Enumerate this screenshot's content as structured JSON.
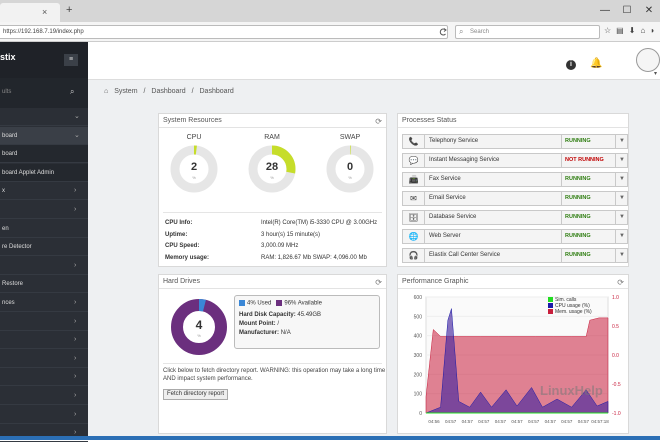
{
  "browser": {
    "tab_close": "×",
    "new_tab": "+",
    "url": "https://192.168.7.19/index.php",
    "search_placeholder": "Search",
    "window_buttons": [
      "—",
      "☐",
      "✕"
    ]
  },
  "sidebar": {
    "logo": "stix",
    "search_placeholder": "ults",
    "items": [
      {
        "label": "",
        "chevron": "⌄"
      },
      {
        "label": "board",
        "chevron": "⌄",
        "active": true
      },
      {
        "label": "board",
        "sub": true
      },
      {
        "label": "board Applet Admin",
        "sub": true
      },
      {
        "label": "x",
        "chevron": "›"
      },
      {
        "label": "",
        "chevron": "›"
      },
      {
        "label": "en"
      },
      {
        "label": "re Detector"
      },
      {
        "label": "",
        "chevron": "›"
      },
      {
        "label": "Restore"
      },
      {
        "label": "nces",
        "chevron": "›"
      },
      {
        "label": "",
        "chevron": "›"
      },
      {
        "label": "",
        "chevron": "›"
      },
      {
        "label": "",
        "chevron": "›"
      },
      {
        "label": "",
        "chevron": "›"
      },
      {
        "label": "",
        "chevron": "›"
      },
      {
        "label": "",
        "chevron": "›"
      },
      {
        "label": "",
        "chevron": "›"
      }
    ]
  },
  "topbar": {
    "info": "i"
  },
  "breadcrumb": {
    "home": "⌂",
    "items": [
      "System",
      "/",
      "Dashboard",
      "/",
      "Dashboard"
    ]
  },
  "system_resources": {
    "title": "System Resources",
    "gauges": [
      {
        "label": "CPU",
        "value": "2",
        "percent": 2,
        "color": "#c6dd2a"
      },
      {
        "label": "RAM",
        "value": "28",
        "percent": 28,
        "color": "#c6dd2a"
      },
      {
        "label": "SWAP",
        "value": "0",
        "percent": 0,
        "color": "#c6dd2a"
      }
    ],
    "pct_sign": "%",
    "info": [
      {
        "k": "CPU Info:",
        "v": "Intel(R) Core(TM) i5-3330 CPU @ 3.00GHz"
      },
      {
        "k": "Uptime:",
        "v": "3 hour(s) 15 minute(s)"
      },
      {
        "k": "CPU Speed:",
        "v": "3,000.09 MHz"
      },
      {
        "k": "Memory usage:",
        "v": "RAM: 1,826.67 Mb SWAP: 4,096.00 Mb"
      }
    ]
  },
  "processes": {
    "title": "Processes Status",
    "items": [
      {
        "icon": "📞",
        "icon_name": "telephone-icon",
        "name": "Telephony Service",
        "status": "RUNNING",
        "color": "#2e7d10"
      },
      {
        "icon": "💬",
        "icon_name": "chat-icon",
        "name": "Instant Messaging Service",
        "status": "NOT RUNNING",
        "color": "#c00000"
      },
      {
        "icon": "📠",
        "icon_name": "fax-icon",
        "name": "Fax Service",
        "status": "RUNNING",
        "color": "#2e7d10"
      },
      {
        "icon": "✉",
        "icon_name": "email-icon",
        "name": "Email Service",
        "status": "RUNNING",
        "color": "#2e7d10"
      },
      {
        "icon": "🗄",
        "icon_name": "database-icon",
        "name": "Database Service",
        "status": "RUNNING",
        "color": "#2e7d10"
      },
      {
        "icon": "🌐",
        "icon_name": "globe-icon",
        "name": "Web Server",
        "status": "RUNNING",
        "color": "#2e7d10"
      },
      {
        "icon": "🎧",
        "icon_name": "headset-icon",
        "name": "Elastix Call Center Service",
        "status": "RUNNING",
        "color": "#2e7d10"
      }
    ]
  },
  "hard_drives": {
    "title": "Hard Drives",
    "center_value": "4",
    "pct_sign": "%",
    "used_label": "4% Used",
    "available_label": "96% Available",
    "used_pct": 4,
    "used_color": "#3a87d6",
    "available_color": "#6b2f7e",
    "capacity_k": "Hard Disk Capacity:",
    "capacity_v": "45.49GB",
    "mount_k": "Mount Point:",
    "mount_v": "/",
    "manufacturer_k": "Manufacturer:",
    "manufacturer_v": "N/A",
    "note": "Click below to fetch directory report. WARNING: this operation may take a long time AND impact system performance.",
    "fetch_button": "Fetch directory report"
  },
  "performance": {
    "title": "Performance Graphic",
    "legend": [
      {
        "label": "Sim. calls",
        "color": "#22dd22"
      },
      {
        "label": "CPU usage (%)",
        "color": "#1a1aa8"
      },
      {
        "label": "Mem. usage (%)",
        "color": "#c81e3c"
      }
    ],
    "left_ticks": [
      "600",
      "500",
      "400",
      "300",
      "200",
      "100",
      "0"
    ],
    "right_ticks": [
      "1.0",
      "0.5",
      "0.0",
      "-0.5",
      "-1.0"
    ],
    "x_ticks": [
      "04:56",
      "04:57",
      "04:57",
      "04:57",
      "04:57",
      "04:57",
      "04:57",
      "04:57",
      "04:57",
      "04:57",
      "04:57:18"
    ],
    "watermark": "LinuxHelp"
  }
}
